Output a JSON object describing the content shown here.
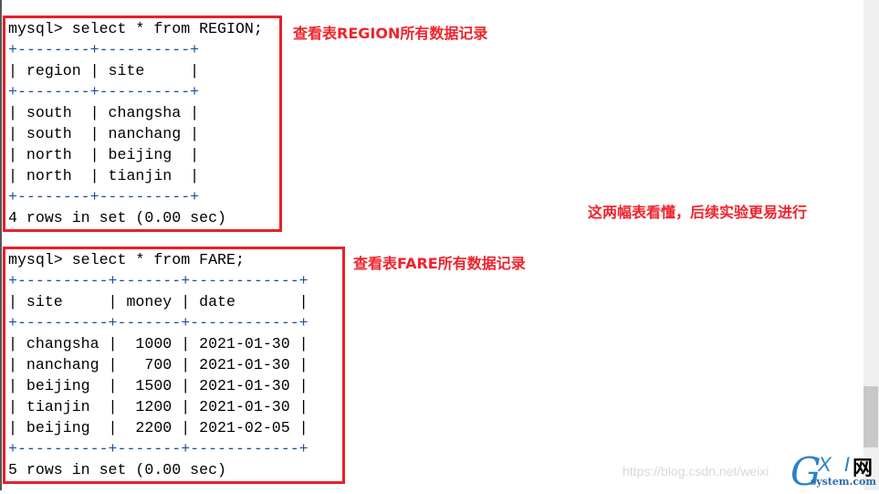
{
  "region_query": {
    "lines": [
      "mysql> select * from REGION;",
      "+--------+----------+",
      "| region | site     |",
      "+--------+----------+",
      "| south  | changsha |",
      "| south  | nanchang |",
      "| north  | beijing  |",
      "| north  | tianjin  |",
      "+--------+----------+",
      "4 rows in set (0.00 sec)"
    ],
    "columns": [
      "region",
      "site"
    ],
    "rows": [
      [
        "south",
        "changsha"
      ],
      [
        "south",
        "nanchang"
      ],
      [
        "north",
        "beijing"
      ],
      [
        "north",
        "tianjin"
      ]
    ]
  },
  "fare_query": {
    "lines": [
      "mysql> select * from FARE;",
      "+----------+-------+------------+",
      "| site     | money | date       |",
      "+----------+-------+------------+",
      "| changsha |  1000 | 2021-01-30 |",
      "| nanchang |   700 | 2021-01-30 |",
      "| beijing  |  1500 | 2021-01-30 |",
      "| tianjin  |  1200 | 2021-01-30 |",
      "| beijing  |  2200 | 2021-02-05 |",
      "+----------+-------+------------+",
      "5 rows in set (0.00 sec)"
    ],
    "columns": [
      "site",
      "money",
      "date"
    ],
    "rows": [
      [
        "changsha",
        "1000",
        "2021-01-30"
      ],
      [
        "nanchang",
        "700",
        "2021-01-30"
      ],
      [
        "beijing",
        "1500",
        "2021-01-30"
      ],
      [
        "tianjin",
        "1200",
        "2021-01-30"
      ],
      [
        "beijing",
        "2200",
        "2021-02-05"
      ]
    ]
  },
  "annotations": {
    "region_note": "查看表REGION所有数据记录",
    "fare_note": "查看表FARE所有数据记录",
    "summary_note": "这两幅表看懂，后续实验更易进行"
  },
  "watermark": "https://blog.csdn.net/weixi",
  "logo": {
    "g": "G",
    "xi": "X I",
    "wang": "网",
    "domain": "system.com"
  },
  "colors": {
    "highlight_box": "#e8202a",
    "annotation": "#f0222b",
    "table_border": "#1f4e9c"
  }
}
